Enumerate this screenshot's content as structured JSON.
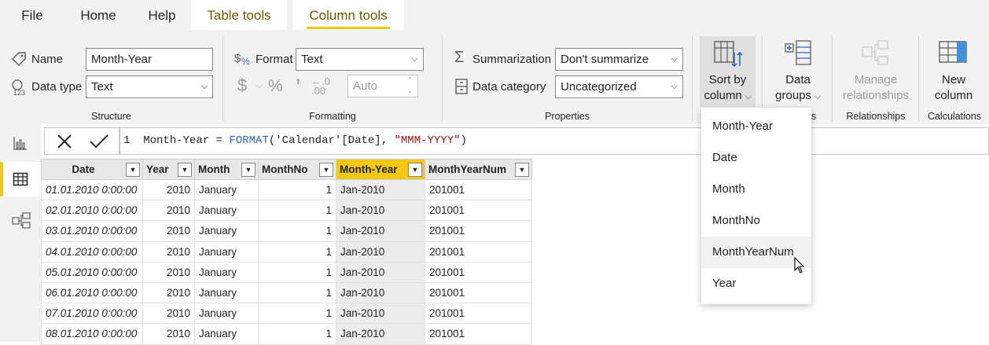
{
  "menubar": {
    "file": "File",
    "home": "Home",
    "help": "Help",
    "table_tools": "Table tools",
    "column_tools": "Column tools"
  },
  "structure": {
    "name_label": "Name",
    "name_value": "Month-Year",
    "datatype_label": "Data type",
    "datatype_value": "Text",
    "group_label": "Structure"
  },
  "formatting": {
    "format_label": "Format",
    "format_value": "Text",
    "auto_value": "Auto",
    "group_label": "Formatting"
  },
  "properties": {
    "summarization_label": "Summarization",
    "summarization_value": "Don't summarize",
    "datacategory_label": "Data category",
    "datacategory_value": "Uncategorized",
    "group_label": "Properties"
  },
  "sort": {
    "line1": "Sort by",
    "line2": "column"
  },
  "groups": {
    "line1": "Data",
    "line2": "groups",
    "group_label_tail": "s"
  },
  "relationships": {
    "line1": "Manage",
    "line2": "relationships",
    "group_label": "Relationships"
  },
  "calculations": {
    "line1": "New",
    "line2": "column",
    "group_label": "Calculations"
  },
  "formula": {
    "line_no": "1",
    "prefix": "Month-Year = ",
    "func": "FORMAT",
    "open": "(",
    "table_ref": "'Calendar'[Date]",
    "comma": ", ",
    "string": "\"MMM-YYYY\"",
    "close": ")"
  },
  "table": {
    "columns": [
      "Date",
      "Year",
      "Month",
      "MonthNo",
      "Month-Year",
      "MonthYearNum"
    ],
    "rows": [
      [
        "01.01.2010 0:00:00",
        "2010",
        "January",
        "1",
        "Jan-2010",
        "201001"
      ],
      [
        "02.01.2010 0:00:00",
        "2010",
        "January",
        "1",
        "Jan-2010",
        "201001"
      ],
      [
        "03.01.2010 0:00:00",
        "2010",
        "January",
        "1",
        "Jan-2010",
        "201001"
      ],
      [
        "04.01.2010 0:00:00",
        "2010",
        "January",
        "1",
        "Jan-2010",
        "201001"
      ],
      [
        "05.01.2010 0:00:00",
        "2010",
        "January",
        "1",
        "Jan-2010",
        "201001"
      ],
      [
        "06.01.2010 0:00:00",
        "2010",
        "January",
        "1",
        "Jan-2010",
        "201001"
      ],
      [
        "07.01.2010 0:00:00",
        "2010",
        "January",
        "1",
        "Jan-2010",
        "201001"
      ],
      [
        "08.01.2010 0:00:00",
        "2010",
        "January",
        "1",
        "Jan-2010",
        "201001"
      ]
    ]
  },
  "sort_dropdown": {
    "items": [
      "Month-Year",
      "Date",
      "Month",
      "MonthNo",
      "MonthYearNum",
      "Year"
    ],
    "hovered": "MonthYearNum"
  },
  "colors": {
    "accent": "#f2c811",
    "function": "#3165bb",
    "string": "#a31515"
  }
}
